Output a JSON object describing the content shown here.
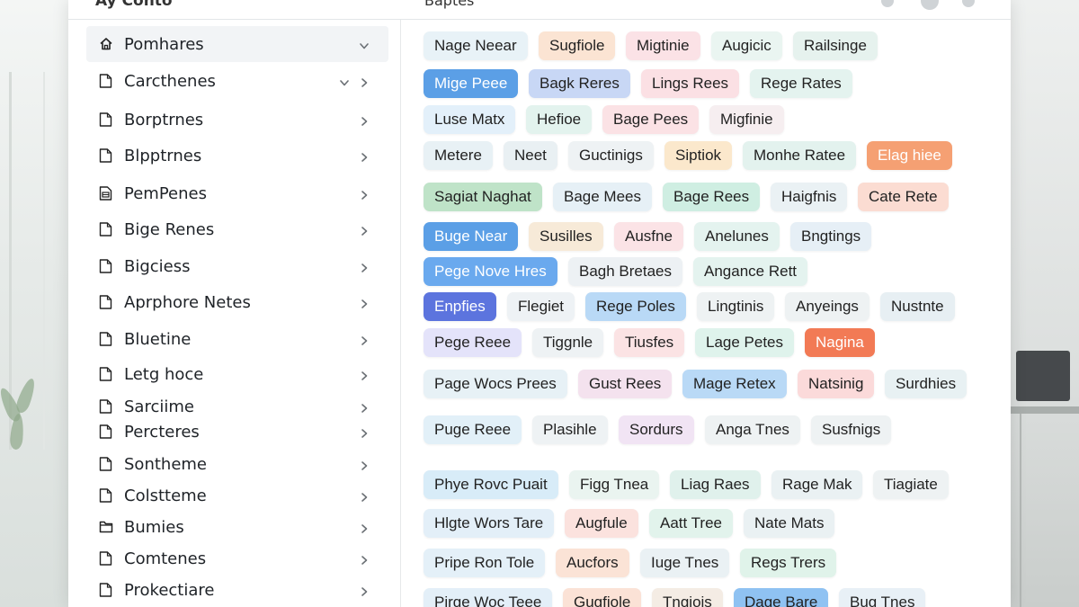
{
  "header": {
    "title_left": "Ay Conto",
    "title_mid": "Baptes"
  },
  "sidebar": {
    "items": [
      {
        "label": "Pomhares",
        "icon": "home-icon",
        "expanded": true
      },
      {
        "label": "Carcthenes",
        "icon": "file-icon",
        "expanded": true
      },
      {
        "label": "Borptrnes",
        "icon": "file-icon"
      },
      {
        "label": "Blpptrnes",
        "icon": "file-icon"
      },
      {
        "label": "PemPenes",
        "icon": "document-list-icon"
      },
      {
        "label": "Bige Renes",
        "icon": "file-icon"
      },
      {
        "label": "Bigciess",
        "icon": "file-icon"
      },
      {
        "label": "Aprphore Netes",
        "icon": "file-icon"
      },
      {
        "label": "Bluetine",
        "icon": "file-icon"
      },
      {
        "label": "Letg hoce",
        "icon": "file-icon"
      },
      {
        "label": "Sarciime",
        "icon": "file-icon"
      },
      {
        "label": "Percteres",
        "icon": "file-icon"
      },
      {
        "label": "Sontheme",
        "icon": "file-icon"
      },
      {
        "label": "Colstteme",
        "icon": "file-icon"
      },
      {
        "label": "Bumies",
        "icon": "folder-icon"
      },
      {
        "label": "Comtenes",
        "icon": "file-icon"
      },
      {
        "label": "Prokectiare",
        "icon": "file-icon"
      }
    ]
  },
  "tag_rows": [
    [
      {
        "label": "Nage Neear",
        "color": "#e8f2f7"
      },
      {
        "label": "Sugfiole",
        "color": "#fbe4d3"
      },
      {
        "label": "Migtinie",
        "color": "#fbe2e6"
      },
      {
        "label": "Augicic",
        "color": "#eaf5f1"
      },
      {
        "label": "Railsinge",
        "color": "#e6f2ee"
      }
    ],
    [
      {
        "label": "Mige Peee",
        "color": "#5b9fe6"
      },
      {
        "label": "Bagk Reres",
        "color": "#c8d7f5"
      },
      {
        "label": "Lings Rees",
        "color": "#fbe0e4"
      },
      {
        "label": "Rege Rates",
        "color": "#e4f3ef"
      }
    ],
    [
      {
        "label": "Luse Matx",
        "color": "#e3f0fa"
      },
      {
        "label": "Hefioe",
        "color": "#e3f3ee"
      },
      {
        "label": "Bage Pees",
        "color": "#fbe2e5"
      },
      {
        "label": "Migfinie",
        "color": "#f6eef0"
      }
    ],
    [
      {
        "label": "Metere",
        "color": "#e8f1f5"
      },
      {
        "label": "Neet",
        "color": "#e9f0f3"
      },
      {
        "label": "Guctinigs",
        "color": "#eef2f4"
      },
      {
        "label": "Siptiok",
        "color": "#fbe8cc"
      },
      {
        "label": "Monhe Ratee",
        "color": "#e3f2ee"
      },
      {
        "label": "Elag hiee",
        "color": "#f5a073"
      }
    ],
    [
      {
        "label": "Sagiat Naghat",
        "color": "#bfe3c8"
      },
      {
        "label": "Bage Mees",
        "color": "#e6f0f6"
      },
      {
        "label": "Bage Rees",
        "color": "#cfeee2"
      },
      {
        "label": "Haigfnis",
        "color": "#eaf1f4"
      },
      {
        "label": "Cate Rete",
        "color": "#fbdcd2"
      }
    ],
    [
      {
        "label": "Buge Near",
        "color": "#5b9fe6"
      },
      {
        "label": "Susilles",
        "color": "#f7ead8"
      },
      {
        "label": "Ausfne",
        "color": "#fbe3e6"
      },
      {
        "label": "Anelunes",
        "color": "#e4f3ef"
      },
      {
        "label": "Bngtings",
        "color": "#e6eff6"
      }
    ],
    [
      {
        "label": "Pege Nove Hres",
        "color": "#6aa9ee"
      },
      {
        "label": "Bagh Bretaes",
        "color": "#edf1f4"
      },
      {
        "label": "Angance Rett",
        "color": "#e4f3ef"
      }
    ],
    [
      {
        "label": "Enpfies",
        "color": "#5c74de"
      },
      {
        "label": "Flegiet",
        "color": "#eef2f5"
      },
      {
        "label": "Rege Poles",
        "color": "#b9d9f6"
      },
      {
        "label": "Lingtinis",
        "color": "#eef2f3"
      },
      {
        "label": "Anyeings",
        "color": "#eef2f3"
      },
      {
        "label": "Nustnte",
        "color": "#e7eff3"
      }
    ],
    [
      {
        "label": "Pege Reee",
        "color": "#e4e3fa"
      },
      {
        "label": "Tiggnle",
        "color": "#eef2f4"
      },
      {
        "label": "Tiusfes",
        "color": "#fbe3e4"
      },
      {
        "label": "Lage Petes",
        "color": "#dff3ec"
      },
      {
        "label": "Nagina",
        "color": "#f27a55"
      }
    ],
    [
      {
        "label": "Page Wocs Prees",
        "color": "#e7f1f6"
      },
      {
        "label": "Gust Rees",
        "color": "#f4e2ee"
      },
      {
        "label": "Mage Retex",
        "color": "#b9d9f6"
      },
      {
        "label": "Natsinig",
        "color": "#fbdada"
      },
      {
        "label": "Surdhies",
        "color": "#e8f1f3"
      }
    ],
    [
      {
        "label": "Puge Reee",
        "color": "#e2f0f8"
      },
      {
        "label": "Plasihle",
        "color": "#eef2f4"
      },
      {
        "label": "Sordurs",
        "color": "#f1e4f4"
      },
      {
        "label": "Anga Tnes",
        "color": "#eef2f3"
      },
      {
        "label": "Susfnigs",
        "color": "#eef2f3"
      }
    ],
    [
      {
        "label": "Phye Rovc Puait",
        "color": "#d8ecf8"
      },
      {
        "label": "Figg Tnea",
        "color": "#eaf4f0"
      },
      {
        "label": "Liag Raes",
        "color": "#e0f1ec"
      },
      {
        "label": "Rage Mak",
        "color": "#eaf1f3"
      },
      {
        "label": "Tiagiate",
        "color": "#eef2f3"
      }
    ],
    [
      {
        "label": "Hlgte Wors Tare",
        "color": "#e3eff8"
      },
      {
        "label": "Augfule",
        "color": "#fbe2de"
      },
      {
        "label": "Aatt Tree",
        "color": "#e2f3ec"
      },
      {
        "label": "Nate Mats",
        "color": "#eaf1f3"
      }
    ],
    [
      {
        "label": "Pripe Ron Tole",
        "color": "#e4f0f8"
      },
      {
        "label": "Aucfors",
        "color": "#fbe3d6"
      },
      {
        "label": "Iuge Tnes",
        "color": "#eaf1f4"
      },
      {
        "label": "Regs Trers",
        "color": "#e0f3ea"
      }
    ],
    [
      {
        "label": "Pirge Woc Teee",
        "color": "#e3eff8"
      },
      {
        "label": "Gugfiole",
        "color": "#fbe2d6"
      },
      {
        "label": "Tngiois",
        "color": "#f4ece4"
      },
      {
        "label": "Dage Bare",
        "color": "#8fc2f2"
      },
      {
        "label": "Bug Tnes",
        "color": "#e8f0f6"
      }
    ]
  ]
}
